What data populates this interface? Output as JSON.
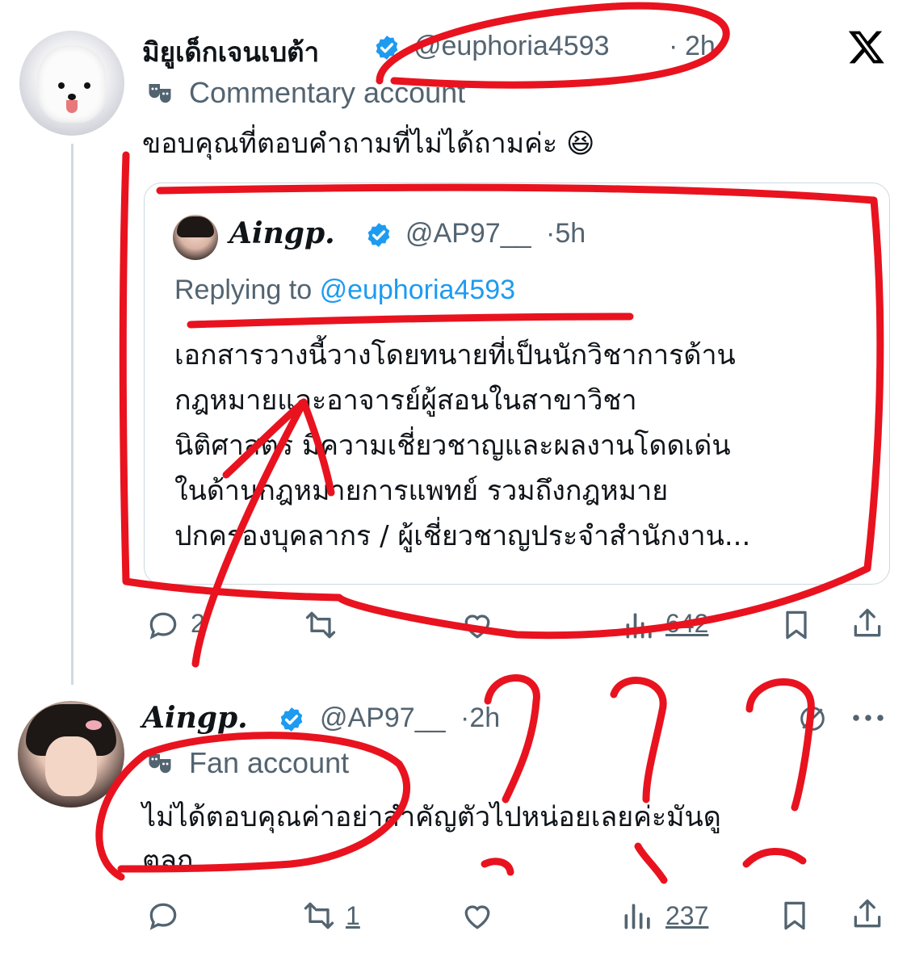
{
  "app": {
    "logo": "x-logo"
  },
  "tweet1": {
    "display_name": "มิยูเด็กเจนเบต้า",
    "handle": "@euphoria4593",
    "time_sep": "·",
    "time": "2h",
    "label_icon": "masks-icon",
    "label": "Commentary account",
    "text": "ขอบคุณที่ตอบคำถามที่ไม่ได้ถามค่ะ",
    "emoji": "😆",
    "quote": {
      "display_name": "𝑨𝒊𝒏𝒈𝒑.",
      "handle": "@AP97__",
      "time": "·5h",
      "replying_prefix": "Replying to",
      "replying_handle": "@euphoria4593",
      "lines": [
        "เอกสารวางนี้วางโดยทนายที่เป็นนักวิชาการด้าน",
        "กฎหมายและอาจารย์ผู้สอนในสาขาวิชา",
        "นิติศาสตร์ มีความเชี่ยวชาญและผลงานโดดเด่น",
        "ในด้านกฎหมายการแพทย์ รวมถึงกฎหมาย",
        "ปกครองบุคลากร / ผู้เชี่ยวชาญประจำสำนักงาน..."
      ]
    },
    "actions": {
      "replies": "2",
      "views": "642"
    }
  },
  "tweet2": {
    "display_name": "𝑨𝒊𝒏𝒈𝒑.",
    "handle": "@AP97__",
    "time": "·2h",
    "label_icon": "masks-icon",
    "label": "Fan account",
    "lines": [
      "ไม่ได้ตอบคุณค่าอย่าสำคัญตัวไปหน่อยเลยค่ะมันดู",
      "ตลก"
    ],
    "actions": {
      "retweets": "1",
      "views": "237"
    }
  },
  "annotation_color": "#e8131f",
  "accent": "#1d9bf0"
}
